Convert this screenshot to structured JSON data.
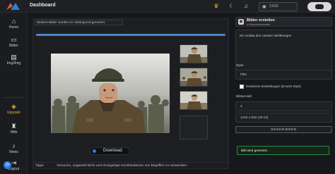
{
  "app": {
    "title": "Dashboard",
    "credits": "3.919"
  },
  "nav": [
    {
      "icon": "home-icon",
      "label": "Home"
    },
    {
      "icon": "image-icon",
      "label": "Bilder"
    },
    {
      "icon": "img2img-icon",
      "label": "Img2Img"
    },
    {
      "icon": "gift-icon",
      "label": "Upgrade"
    },
    {
      "icon": "graduation-cap-icon",
      "label": "Hilfe"
    },
    {
      "icon": "bell-icon",
      "label": "News"
    },
    {
      "icon": "logout-icon",
      "label": "Logout"
    }
  ],
  "main": {
    "banner": "Weitere Bilder werden im Hintergrund generiert.",
    "progress": 1,
    "download_label": "Download",
    "tips_label": "Tipps",
    "tips_text": "Versuche, ungewöhnliche und einzigartige Kombinationen von Begriffen zu verwenden."
  },
  "panel": {
    "title": "Bilder erstellen",
    "subtitle": "in Sekundenschnelle",
    "prompt": "Ein Soldat des zweiten Weltkrieges",
    "style_label": "Style",
    "style_value": "Film",
    "checkbox_label": "Erweiterte Einstellungen (Ersetzt Style)",
    "count_label": "Bildanzahl",
    "count_value": "4",
    "size_value": "1216 x 832 (19:13)",
    "generate_label": "GENERIEREN",
    "status": "Bild wird generiert."
  },
  "colors": {
    "accent": "#4d86c7",
    "upgrade": "#e7b41b",
    "success": "#2b8a3e"
  }
}
